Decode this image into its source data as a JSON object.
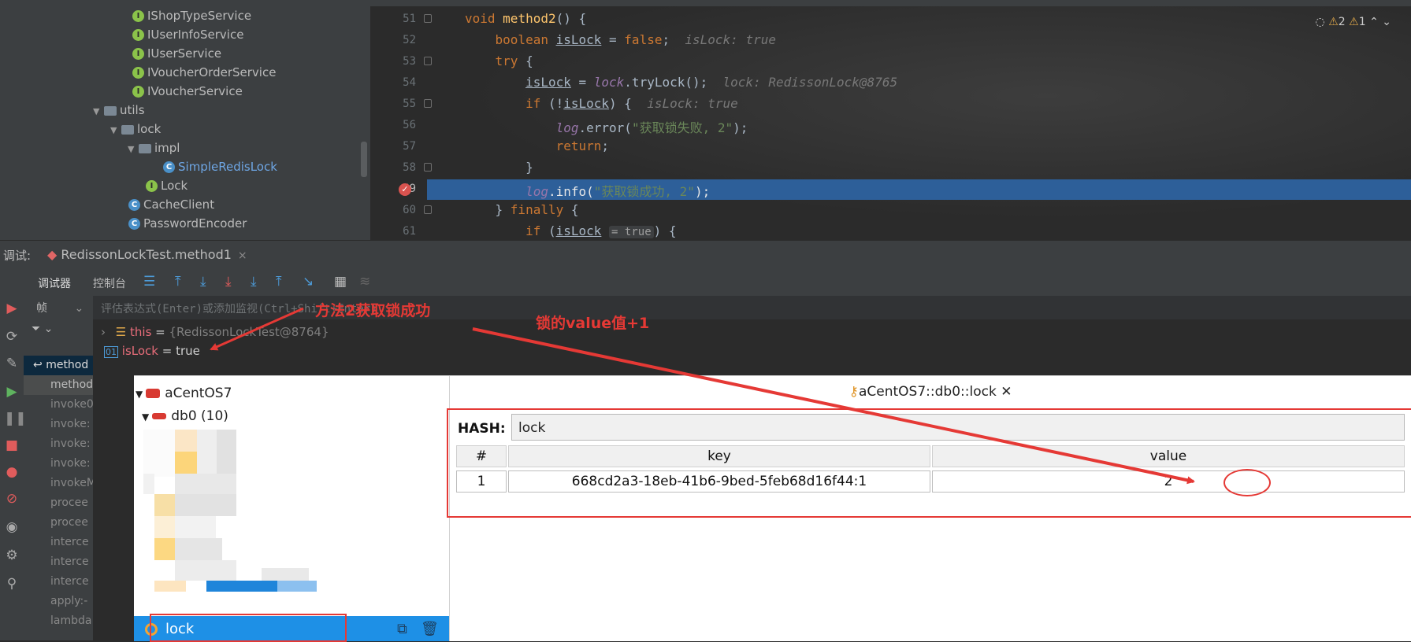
{
  "project_tree": {
    "items": [
      {
        "label": "IShopTypeService",
        "icon": "interface-icon"
      },
      {
        "label": "IUserInfoService",
        "icon": "interface-icon"
      },
      {
        "label": "IUserService",
        "icon": "interface-icon"
      },
      {
        "label": "IVoucherOrderService",
        "icon": "interface-icon"
      },
      {
        "label": "IVoucherService",
        "icon": "interface-icon"
      },
      {
        "label": "utils",
        "icon": "folder-icon"
      },
      {
        "label": "lock",
        "icon": "folder-icon"
      },
      {
        "label": "impl",
        "icon": "folder-icon"
      },
      {
        "label": "SimpleRedisLock",
        "icon": "class-icon"
      },
      {
        "label": "Lock",
        "icon": "interface-icon"
      },
      {
        "label": "CacheClient",
        "icon": "class-icon"
      },
      {
        "label": "PasswordEncoder",
        "icon": "class-icon"
      }
    ]
  },
  "editor": {
    "line_numbers": [
      "51",
      "52",
      "53",
      "54",
      "55",
      "56",
      "57",
      "58",
      "59",
      "60",
      "61"
    ],
    "inspection": {
      "warnings": "2",
      "weak_warnings": "1"
    },
    "inline_values": {
      "line52": "isLock: true",
      "line54": "lock: RedissonLock@8765",
      "line55": "isLock: true",
      "line61": "= true"
    },
    "strings": {
      "error_msg": "\"获取锁失败, 2\"",
      "info_msg": "\"获取锁成功, 2\""
    }
  },
  "debug": {
    "label": "调试:",
    "session_tab": "RedissonLockTest.method1",
    "tabs": {
      "debugger": "调试器",
      "console": "控制台"
    },
    "frames_label": "帧",
    "eval_placeholder": "评估表达式(Enter)或添加监视(Ctrl+Shift+Enter)",
    "frames": [
      "method",
      "method",
      "invoke0",
      "invoke:",
      "invoke:",
      "invoke:",
      "invokeM",
      "procee",
      "procee",
      "interce",
      "interce",
      "interce",
      "apply:-",
      "lambda"
    ],
    "variables": [
      {
        "name": "this",
        "value": "{RedissonLockTest@8764}"
      },
      {
        "name": "isLock",
        "value": "true"
      }
    ]
  },
  "annotations": {
    "acquire_success": "方法2获取锁成功",
    "value_plus_one": "锁的value值+1"
  },
  "redis": {
    "connection": "aCentOS7",
    "database": "db0",
    "db_count": "(10)",
    "selected_key": "lock",
    "tab_title": "aCentOS7::db0::lock",
    "hash_label": "HASH:",
    "hash_name": "lock",
    "columns": [
      "#",
      "key",
      "value"
    ],
    "rows": [
      {
        "index": "1",
        "key": "668cd2a3-18eb-41b6-9bed-5feb68d16f44:1",
        "value": "2"
      }
    ]
  },
  "colors": {
    "accent": "#2d5f99",
    "annotation": "#e53935",
    "redis_selection": "#1e90e6"
  }
}
